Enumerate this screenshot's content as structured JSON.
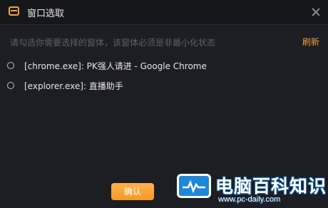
{
  "window": {
    "title": "窗口选取",
    "close_icon": "close-icon"
  },
  "hint_text": "请勾选你需要选择的窗体，该窗体必须是非最小化状态",
  "refresh_label": "刷新",
  "windows": [
    {
      "label": "[chrome.exe]: PK强人请进 - Google Chrome"
    },
    {
      "label": "[explorer.exe]: 直播助手"
    }
  ],
  "confirm_label": "确认",
  "colors": {
    "accent": "#f7a23a",
    "background": "#1d1e23"
  },
  "watermark": {
    "text": "电脑百科知识",
    "url": "www.pc-daily.com"
  }
}
